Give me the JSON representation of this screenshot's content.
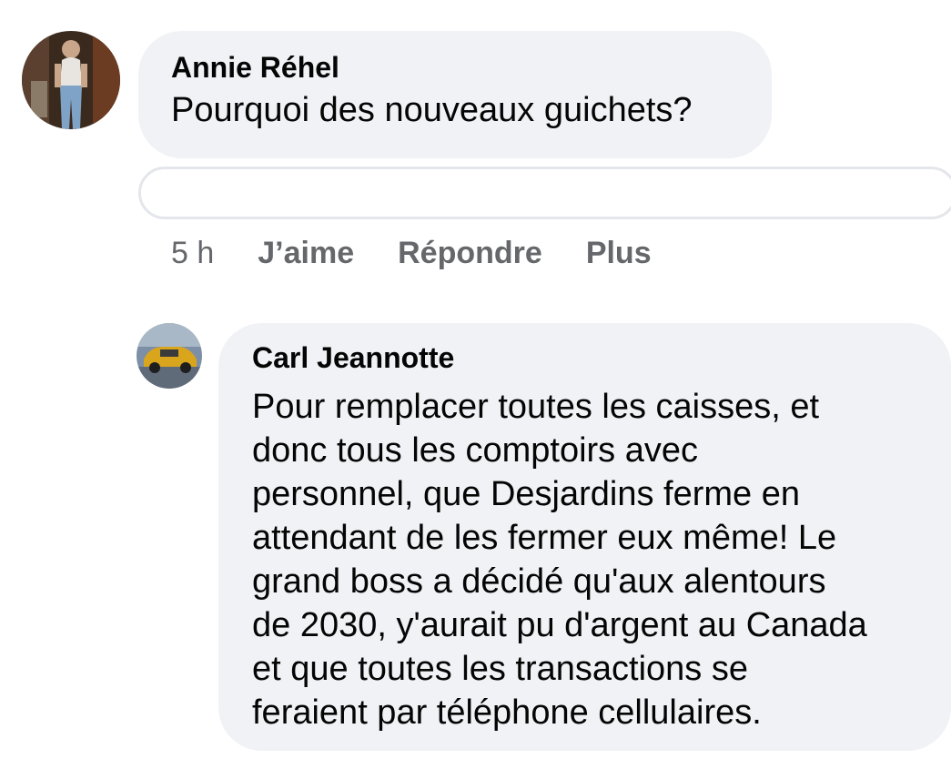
{
  "comments": [
    {
      "author": "Annie Réhel",
      "text": "Pourquoi des nouveaux guichets?",
      "time": "5 h",
      "actions": [
        "J’aime",
        "Répondre",
        "Plus"
      ]
    },
    {
      "author": "Carl Jeannotte",
      "text_lines": [
        "Pour remplacer toutes les caisses, et",
        "donc tous les comptoirs avec",
        "personnel, que Desjardins ferme en",
        "attendant de les fermer eux même! Le",
        "grand boss a décidé qu'aux alentours",
        "de 2030, y'aurait pu d'argent au Canada",
        "et que toutes les transactions se",
        "feraient par téléphone cellulaires."
      ]
    }
  ],
  "reply_input": {
    "placeholder": ""
  },
  "colors": {
    "bubble": "#f0f2f5",
    "meta_text": "#65676b",
    "input_border": "#e4e6eb"
  }
}
